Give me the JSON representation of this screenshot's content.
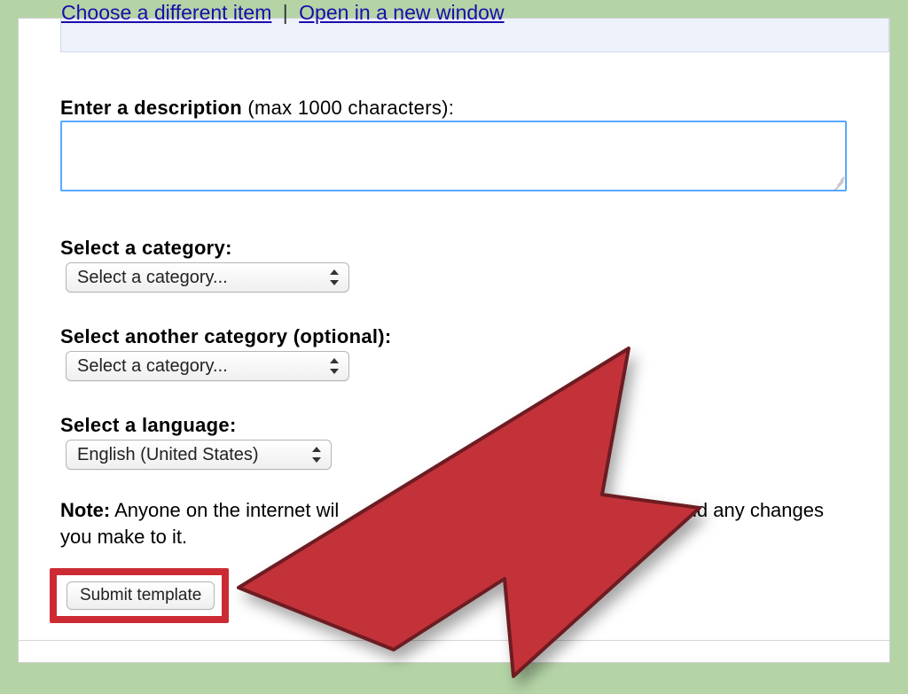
{
  "top_links": {
    "choose_different": "Choose a different item",
    "open_new_window": "Open in a new window",
    "separator": "|"
  },
  "description": {
    "label_bold": "Enter a description",
    "label_rest": " (max 1000 characters):",
    "value": ""
  },
  "category1": {
    "label": "Select a category:",
    "selected": "Select a category..."
  },
  "category2": {
    "label": "Select another category (optional):",
    "selected": "Select a category..."
  },
  "language": {
    "label": "Select a language:",
    "selected": "English (United States)"
  },
  "note": {
    "bold": "Note:",
    "text_before": " Anyone on the internet wil",
    "text_after": "ur template and any changes you make to it."
  },
  "submit": {
    "label": "Submit template"
  },
  "colors": {
    "page_bg": "#b4d4a6",
    "highlight_red": "#cc2b34",
    "link_blue": "#1a0dab",
    "focus_blue": "#58a9ff"
  }
}
